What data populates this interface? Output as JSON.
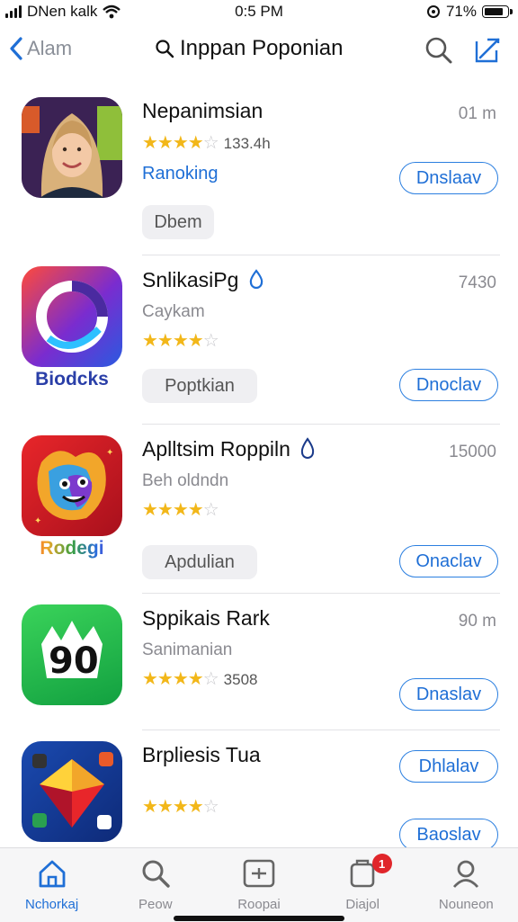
{
  "status_bar": {
    "carrier": "DNen kalk",
    "time": "0:5 PM",
    "battery_pct": "71%"
  },
  "nav": {
    "back_label": "Alam",
    "title": "Inppan Poponian"
  },
  "apps": [
    {
      "name": "Nepanimsian",
      "stars": 4,
      "rating_count": "133.4h",
      "link": "Ranoking",
      "meta": "01 m",
      "pill": "Dbem",
      "button": "Dnslaav"
    },
    {
      "name": "SnlikasiPg",
      "subtitle": "Caykam",
      "stars": 4,
      "meta": "7430",
      "brand": "Biodcks",
      "pill": "Poptkian",
      "button": "Dnoclav"
    },
    {
      "name": "Aplltsim Roppiln",
      "subtitle": "Beh oldndn",
      "stars": 4,
      "meta": "15000",
      "brand": "Rodegi",
      "pill": "Apdulian",
      "button": "Onaclav"
    },
    {
      "name": "Sppikais Rark",
      "subtitle": "Sanimanian",
      "stars": 4,
      "rating_count": "3508",
      "meta": "90 m",
      "button": "Dnaslav"
    },
    {
      "name": "Brpliesis Tua",
      "stars": 4,
      "button": "Dhlalav",
      "button2": "Baoslav"
    }
  ],
  "tabs": [
    {
      "label": "Nchorkaj",
      "icon": "home-icon",
      "active": true
    },
    {
      "label": "Peow",
      "icon": "search-icon"
    },
    {
      "label": "Roopai",
      "icon": "apps-icon"
    },
    {
      "label": "Diajol",
      "icon": "updates-icon",
      "badge": "1"
    },
    {
      "label": "Nouneon",
      "icon": "account-icon"
    }
  ],
  "colors": {
    "accent": "#1f6fd6",
    "star": "#f2b719",
    "badge": "#e0262b"
  }
}
